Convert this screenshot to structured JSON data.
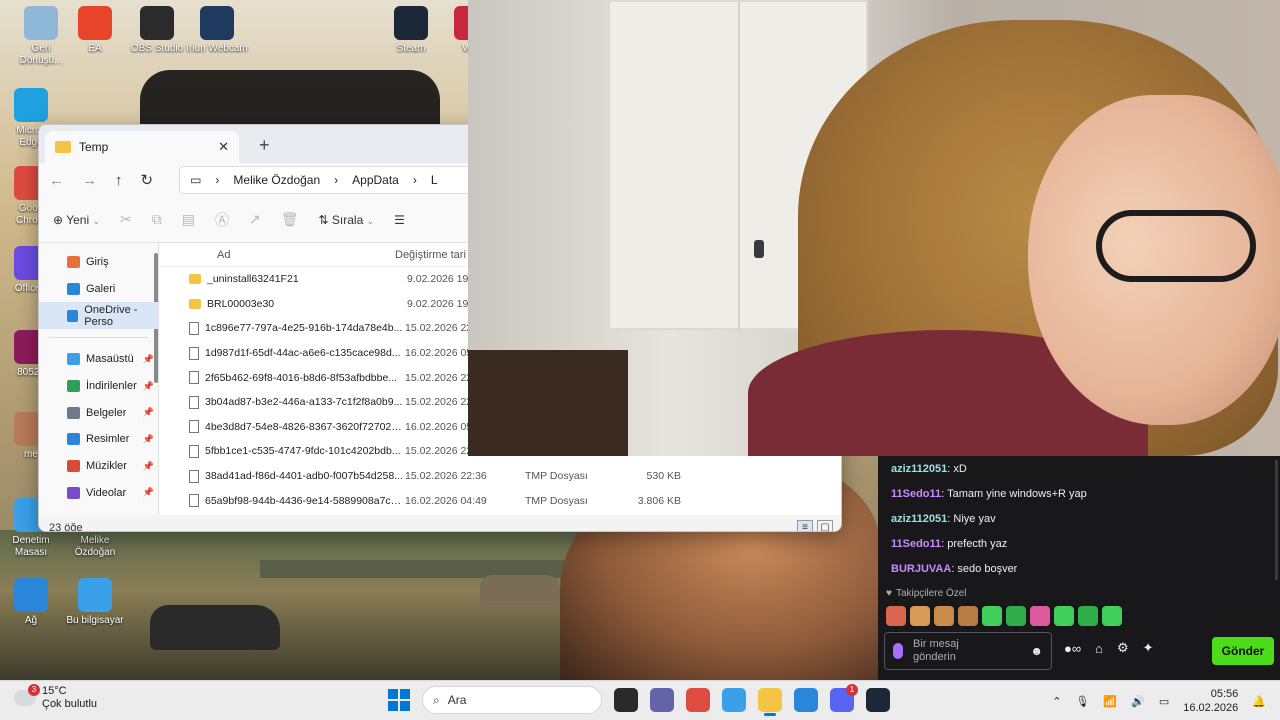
{
  "desktop": {
    "icons": [
      {
        "label": "Geri\nDönüşü...",
        "icon": "recycle-bin-icon",
        "color": "#8fb7d8"
      },
      {
        "label": "EA",
        "icon": "ea-icon",
        "color": "#e8442c"
      },
      {
        "label": "OBS Studio",
        "icon": "obs-icon",
        "color": "#2b2b2b"
      },
      {
        "label": "Iriun Webcam",
        "icon": "iriun-webcam-icon",
        "color": "#1e3a5f"
      },
      {
        "label": "Steam",
        "icon": "steam-icon",
        "color": "#1b2838"
      },
      {
        "label": "VAL",
        "icon": "valorant-icon",
        "color": "#c6283c"
      },
      {
        "label": "Micros\nEdge",
        "icon": "edge-icon",
        "color": "#1fa1e0"
      },
      {
        "label": "Goog\nChrom",
        "icon": "chrome-icon",
        "color": "#de4b3f"
      },
      {
        "label": "OfficeS",
        "icon": "office-icon",
        "color": "#6a4de0"
      },
      {
        "label": "80525",
        "icon": "winrar-icon",
        "color": "#8c1c5a"
      },
      {
        "label": "me",
        "icon": "photo-icon",
        "color": "#b87a5a"
      },
      {
        "label": "Denetim\nMasası",
        "icon": "control-panel-icon",
        "color": "#3aa0e8"
      },
      {
        "label": "Melike\nÖzdoğan",
        "icon": "user-folder-icon",
        "color": "#f4c542"
      },
      {
        "label": "Ağ",
        "icon": "network-icon",
        "color": "#2a86d8"
      },
      {
        "label": "Bu bilgisayar",
        "icon": "this-pc-icon",
        "color": "#3aa0e8"
      }
    ]
  },
  "explorer": {
    "tab_title": "Temp",
    "new_tab": "+",
    "breadcrumb": [
      "Melike Özdoğan",
      "AppData",
      "L"
    ],
    "toolbar": {
      "new_label": "Yeni",
      "sort_label": "Sırala"
    },
    "nav_items": [
      {
        "label": "Giriş",
        "icon": "home-icon",
        "color": "#e8703a",
        "pinned": false
      },
      {
        "label": "Galeri",
        "icon": "gallery-icon",
        "color": "#2a86d8",
        "pinned": false
      },
      {
        "label": "OneDrive - Perso",
        "icon": "onedrive-icon",
        "color": "#2a86d8",
        "pinned": false,
        "selected": true
      },
      {
        "label": "Masaüstü",
        "icon": "desktop-icon",
        "color": "#3aa0e8",
        "pinned": true
      },
      {
        "label": "İndirilenler",
        "icon": "downloads-icon",
        "color": "#2e9e5b",
        "pinned": true
      },
      {
        "label": "Belgeler",
        "icon": "documents-icon",
        "color": "#6b7b8c",
        "pinned": true
      },
      {
        "label": "Resimler",
        "icon": "pictures-icon",
        "color": "#2a86d8",
        "pinned": true
      },
      {
        "label": "Müzikler",
        "icon": "music-icon",
        "color": "#d84a3a",
        "pinned": true
      },
      {
        "label": "Videolar",
        "icon": "videos-icon",
        "color": "#7a4ac8",
        "pinned": true
      }
    ],
    "columns": {
      "name": "Ad",
      "date": "Değiştirme tari"
    },
    "files": [
      {
        "name": "_uninstall63241F21",
        "date": "9.02.2026 19:24",
        "type": "",
        "size": "",
        "kind": "folder"
      },
      {
        "name": "BRL00003e30",
        "date": "9.02.2026 19:24",
        "type": "",
        "size": "",
        "kind": "folder"
      },
      {
        "name": "1c896e77-797a-4e25-916b-174da78e4b...",
        "date": "15.02.2026 22:3",
        "type": "",
        "size": "",
        "kind": "file"
      },
      {
        "name": "1d987d1f-65df-44ac-a6e6-c135cace98d...",
        "date": "16.02.2026 05:3",
        "type": "",
        "size": "",
        "kind": "file"
      },
      {
        "name": "2f65b462-69f8-4016-b8d6-8f53afbdbbe...",
        "date": "15.02.2026 22:3",
        "type": "",
        "size": "",
        "kind": "file"
      },
      {
        "name": "3b04ad87-b3e2-446a-a133-7c1f2f8a0b9...",
        "date": "15.02.2026 22:3",
        "type": "",
        "size": "",
        "kind": "file"
      },
      {
        "name": "4be3d8d7-54e8-4826-8367-3620f727023...",
        "date": "16.02.2026 05:0",
        "type": "",
        "size": "",
        "kind": "file"
      },
      {
        "name": "5fbb1ce1-c535-4747-9fdc-101c4202bdb...",
        "date": "15.02.2026 22:3",
        "type": "",
        "size": "",
        "kind": "file"
      },
      {
        "name": "38ad41ad-f86d-4401-adb0-f007b54d258...",
        "date": "15.02.2026 22:36",
        "type": "TMP Dosyası",
        "size": "530 KB",
        "kind": "file"
      },
      {
        "name": "65a9bf98-944b-4436-9e14-5889908a7ca...",
        "date": "16.02.2026 04:49",
        "type": "TMP Dosyası",
        "size": "3.806 KB",
        "kind": "file"
      }
    ],
    "status": "23 öğe"
  },
  "chat": {
    "messages": [
      {
        "user": "aziz112051",
        "text": ": xD",
        "color": "#9be1e0"
      },
      {
        "user": "11Sedo11",
        "text": ": Tamam yine windows+R yap",
        "color": "#c98bff"
      },
      {
        "user": "aziz112051",
        "text": ": Niye yav",
        "color": "#9be1e0"
      },
      {
        "user": "11Sedo11",
        "text": ": prefecth yaz",
        "color": "#c98bff"
      },
      {
        "user": "BURJUVAA",
        "text": ": sedo boşver",
        "color": "#c98bff"
      }
    ],
    "followers_label": "Takipçilere Özel",
    "emotes": [
      "#d9674f",
      "#d89b5a",
      "#c98a4a",
      "#b97b45",
      "#3fcf5a",
      "#2fae4a",
      "#e05aa0",
      "#3fcf5a",
      "#2fae4a",
      "#3fcf5a"
    ],
    "input_placeholder": "Bir mesaj\ngönderin",
    "infinity": "∞",
    "send_label": "Gönder"
  },
  "taskbar": {
    "weather_badge": "3",
    "temperature": "15°C",
    "condition": "Çok bulutlu",
    "search_placeholder": "Ara",
    "apps": [
      {
        "icon": "task-view-icon",
        "color": "#2a2a2a"
      },
      {
        "icon": "teams-icon",
        "color": "#6264a7"
      },
      {
        "icon": "chrome-icon",
        "color": "#de4b3f"
      },
      {
        "icon": "copilot-icon",
        "color": "#3aa0e8"
      },
      {
        "icon": "file-explorer-icon",
        "color": "#f4c542",
        "active": true
      },
      {
        "icon": "store-icon",
        "color": "#2a86d8"
      },
      {
        "icon": "discord-icon",
        "color": "#5865f2",
        "badge": "1"
      },
      {
        "icon": "steam-icon",
        "color": "#1b2838"
      }
    ],
    "time": "05:56",
    "date": "16.02.2026"
  }
}
